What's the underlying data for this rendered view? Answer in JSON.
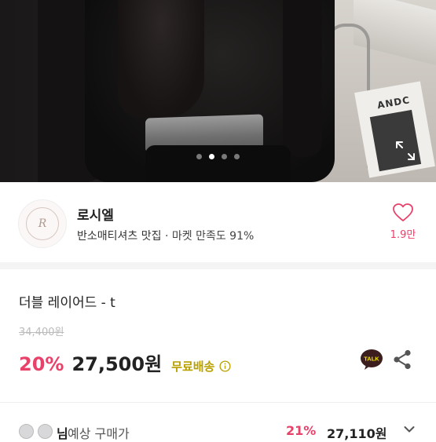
{
  "photo": {
    "magazine_text": "ANDC",
    "carousel": {
      "total": 4,
      "active_index": 1
    },
    "expand_icon": "expand-icon"
  },
  "seller": {
    "avatar_text": "R",
    "name": "로시엘",
    "tagline": "반소매티셔츠 맛집",
    "separator": "·",
    "satisfaction": "마켓 만족도 91%",
    "likes": "1.9만",
    "heart_icon": "heart-icon"
  },
  "product": {
    "title": "더블 레이어드 - t",
    "original_price": "34,400원",
    "discount": "20%",
    "price": "27,500원",
    "shipping": "무료배송",
    "talk_icon": "talk-icon",
    "talk_label": "TALK",
    "share_icon": "share-icon"
  },
  "expected": {
    "name_suffix": "님",
    "label": "예상 구매가",
    "discount": "21%",
    "price": "27,110원"
  },
  "colors": {
    "accent": "#e8416a",
    "shipping": "#b8a000",
    "kakao": "#3c1e1e"
  }
}
